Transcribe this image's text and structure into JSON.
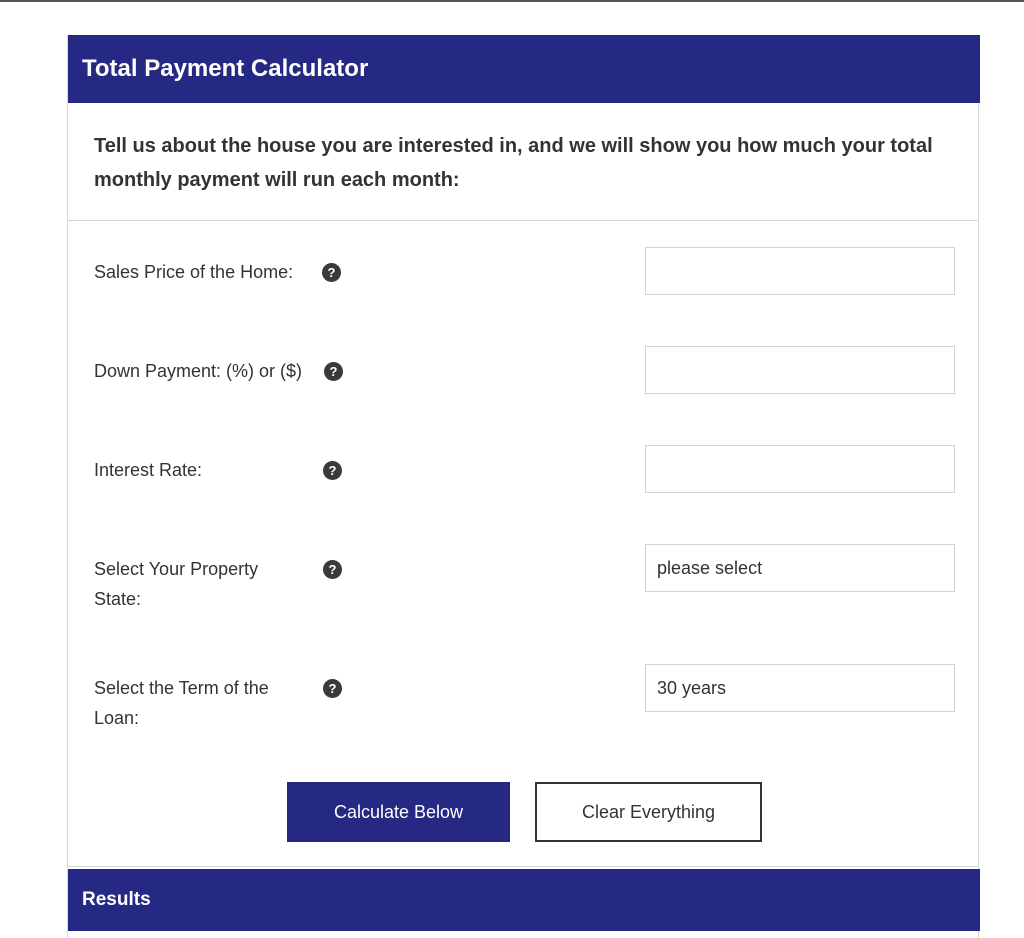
{
  "header": {
    "title": "Total Payment Calculator"
  },
  "intro": {
    "text": "Tell us about the house you are interested in, and we will show you how much your total monthly payment will run each month:"
  },
  "fields": [
    {
      "label": "Sales Price of the Home:",
      "value": "",
      "help_icon": "question-circle-icon"
    },
    {
      "label": "Down Payment: (%) or ($)",
      "value": "",
      "help_icon": "question-circle-icon"
    },
    {
      "label": "Interest Rate:",
      "value": "",
      "help_icon": "question-circle-icon"
    },
    {
      "label": "Select Your Property State:",
      "selected": "please select",
      "help_icon": "question-circle-icon"
    },
    {
      "label": "Select the Term of the Loan:",
      "selected": "30 years",
      "help_icon": "question-circle-icon"
    }
  ],
  "buttons": {
    "calculate": "Calculate Below",
    "clear": "Clear Everything"
  },
  "results": {
    "title": "Results"
  },
  "colors": {
    "brand": "#262983",
    "text": "#333333",
    "border": "#d4d4d4"
  }
}
